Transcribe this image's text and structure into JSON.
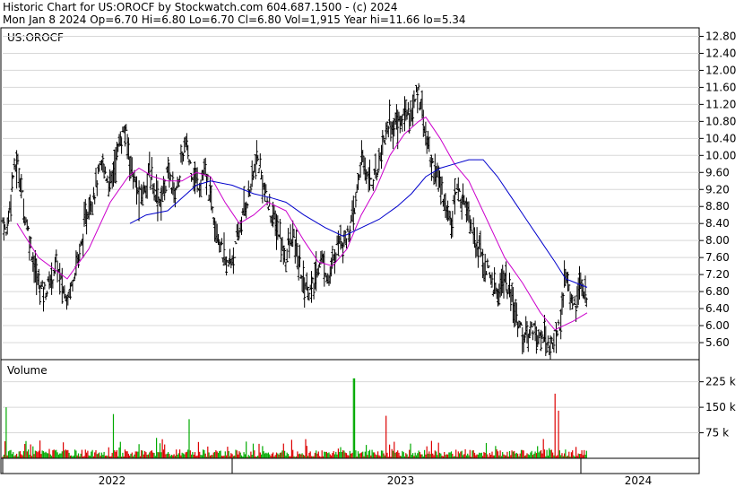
{
  "header": {
    "line1": "Historic Chart for US:OROCF by Stockwatch.com 604.687.1500 - (c) 2024",
    "line2": "Mon Jan  8 2024  Op=6.70  Hi=6.80  Lo=6.70  Cl=6.80  Vol=1,915  Year hi=11.66  lo=5.34"
  },
  "chart_data": [
    {
      "type": "candlestick",
      "panel_label": "US:OROCF",
      "ylim": [
        5.2,
        13.0
      ],
      "y_ticks": [
        "12.80",
        "12.40",
        "12.00",
        "11.60",
        "11.20",
        "10.80",
        "10.40",
        "10.00",
        "9.60",
        "9.20",
        "8.80",
        "8.40",
        "8.00",
        "7.60",
        "7.20",
        "6.80",
        "6.40",
        "6.00",
        "5.60"
      ],
      "x_labels": [
        "2022",
        "2023",
        "2024"
      ],
      "price_path": [
        [
          0,
          8.5
        ],
        [
          4,
          8.1
        ],
        [
          8,
          8.9
        ],
        [
          12,
          9.6
        ],
        [
          16,
          9.8
        ],
        [
          20,
          9.4
        ],
        [
          24,
          8.7
        ],
        [
          28,
          8.3
        ],
        [
          32,
          7.8
        ],
        [
          36,
          7.3
        ],
        [
          40,
          7.0
        ],
        [
          44,
          6.9
        ],
        [
          48,
          6.8
        ],
        [
          52,
          7.0
        ],
        [
          56,
          7.2
        ],
        [
          60,
          7.5
        ],
        [
          64,
          7.1
        ],
        [
          68,
          6.8
        ],
        [
          72,
          6.7
        ],
        [
          76,
          6.9
        ],
        [
          80,
          7.3
        ],
        [
          84,
          7.6
        ],
        [
          88,
          7.9
        ],
        [
          92,
          8.4
        ],
        [
          96,
          8.8
        ],
        [
          100,
          9.0
        ],
        [
          104,
          9.3
        ],
        [
          108,
          9.6
        ],
        [
          112,
          9.8
        ],
        [
          116,
          9.5
        ],
        [
          120,
          9.3
        ],
        [
          124,
          9.7
        ],
        [
          128,
          10.1
        ],
        [
          132,
          10.4
        ],
        [
          136,
          10.6
        ],
        [
          140,
          10.2
        ],
        [
          144,
          9.7
        ],
        [
          148,
          9.3
        ],
        [
          152,
          9.0
        ],
        [
          156,
          9.1
        ],
        [
          160,
          9.4
        ],
        [
          164,
          9.6
        ],
        [
          168,
          9.3
        ],
        [
          172,
          9.1
        ],
        [
          176,
          8.9
        ],
        [
          180,
          9.2
        ],
        [
          184,
          9.6
        ],
        [
          188,
          9.4
        ],
        [
          192,
          9.1
        ],
        [
          196,
          9.4
        ],
        [
          200,
          9.9
        ],
        [
          204,
          10.3
        ],
        [
          208,
          9.9
        ],
        [
          212,
          9.6
        ],
        [
          216,
          9.4
        ],
        [
          220,
          9.3
        ],
        [
          224,
          9.6
        ],
        [
          228,
          9.4
        ],
        [
          232,
          9.0
        ],
        [
          236,
          8.6
        ],
        [
          240,
          8.2
        ],
        [
          244,
          7.8
        ],
        [
          248,
          7.5
        ],
        [
          252,
          7.4
        ],
        [
          256,
          7.6
        ],
        [
          260,
          7.8
        ],
        [
          264,
          8.2
        ],
        [
          268,
          8.6
        ],
        [
          272,
          8.9
        ],
        [
          276,
          9.2
        ],
        [
          280,
          9.6
        ],
        [
          284,
          9.9
        ],
        [
          288,
          9.6
        ],
        [
          292,
          9.2
        ],
        [
          296,
          8.8
        ],
        [
          300,
          8.6
        ],
        [
          304,
          8.4
        ],
        [
          308,
          8.2
        ],
        [
          312,
          7.8
        ],
        [
          316,
          7.6
        ],
        [
          320,
          7.9
        ],
        [
          324,
          8.1
        ],
        [
          328,
          7.7
        ],
        [
          332,
          7.3
        ],
        [
          336,
          7.0
        ],
        [
          340,
          6.9
        ],
        [
          344,
          6.8
        ],
        [
          348,
          7.0
        ],
        [
          352,
          7.4
        ],
        [
          356,
          7.6
        ],
        [
          360,
          7.3
        ],
        [
          364,
          7.1
        ],
        [
          368,
          7.4
        ],
        [
          372,
          7.8
        ],
        [
          376,
          8.1
        ],
        [
          380,
          8.0
        ],
        [
          384,
          8.1
        ],
        [
          388,
          8.3
        ],
        [
          392,
          8.6
        ],
        [
          396,
          9.3
        ],
        [
          400,
          9.9
        ],
        [
          404,
          9.7
        ],
        [
          408,
          9.6
        ],
        [
          412,
          9.4
        ],
        [
          416,
          9.5
        ],
        [
          420,
          9.9
        ],
        [
          424,
          10.3
        ],
        [
          428,
          10.6
        ],
        [
          432,
          10.8
        ],
        [
          436,
          10.6
        ],
        [
          440,
          10.9
        ],
        [
          444,
          10.7
        ],
        [
          448,
          11.0
        ],
        [
          452,
          11.1
        ],
        [
          456,
          10.9
        ],
        [
          460,
          11.3
        ],
        [
          464,
          11.5
        ],
        [
          468,
          11.2
        ],
        [
          472,
          10.4
        ],
        [
          476,
          10.1
        ],
        [
          480,
          9.7
        ],
        [
          484,
          9.6
        ],
        [
          488,
          9.3
        ],
        [
          492,
          9.0
        ],
        [
          496,
          8.7
        ],
        [
          500,
          8.5
        ],
        [
          504,
          9.0
        ],
        [
          508,
          9.2
        ],
        [
          512,
          8.9
        ],
        [
          516,
          9.0
        ],
        [
          520,
          8.7
        ],
        [
          524,
          8.3
        ],
        [
          528,
          8.0
        ],
        [
          532,
          7.8
        ],
        [
          536,
          7.5
        ],
        [
          540,
          7.3
        ],
        [
          544,
          7.1
        ],
        [
          548,
          6.9
        ],
        [
          552,
          6.7
        ],
        [
          556,
          7.0
        ],
        [
          560,
          7.1
        ],
        [
          564,
          6.8
        ],
        [
          568,
          6.5
        ],
        [
          572,
          6.3
        ],
        [
          576,
          6.1
        ],
        [
          580,
          5.8
        ],
        [
          584,
          5.7
        ],
        [
          588,
          5.9
        ],
        [
          592,
          6.0
        ],
        [
          596,
          5.8
        ],
        [
          600,
          5.6
        ],
        [
          604,
          5.8
        ],
        [
          608,
          5.6
        ],
        [
          612,
          5.5
        ],
        [
          616,
          5.7
        ],
        [
          620,
          6.0
        ],
        [
          624,
          6.3
        ],
        [
          628,
          7.2
        ],
        [
          632,
          7.0
        ],
        [
          636,
          6.4
        ],
        [
          640,
          6.5
        ],
        [
          644,
          7.1
        ],
        [
          648,
          6.6
        ],
        [
          652,
          6.8
        ]
      ],
      "series": [
        {
          "name": "",
          "color": "#cc00cc",
          "points": [
            [
              16,
              8.4
            ],
            [
              40,
              7.6
            ],
            [
              72,
              7.1
            ],
            [
              96,
              7.8
            ],
            [
              120,
              8.9
            ],
            [
              140,
              9.5
            ],
            [
              152,
              9.7
            ],
            [
              168,
              9.5
            ],
            [
              184,
              9.4
            ],
            [
              200,
              9.4
            ],
            [
              216,
              9.6
            ],
            [
              232,
              9.5
            ],
            [
              248,
              8.9
            ],
            [
              264,
              8.4
            ],
            [
              280,
              8.6
            ],
            [
              296,
              8.9
            ],
            [
              316,
              8.7
            ],
            [
              336,
              8.0
            ],
            [
              352,
              7.5
            ],
            [
              368,
              7.4
            ],
            [
              384,
              7.8
            ],
            [
              400,
              8.6
            ],
            [
              416,
              9.2
            ],
            [
              432,
              10.0
            ],
            [
              448,
              10.5
            ],
            [
              464,
              10.8
            ],
            [
              472,
              10.9
            ],
            [
              488,
              10.4
            ],
            [
              504,
              9.8
            ],
            [
              520,
              9.4
            ],
            [
              540,
              8.5
            ],
            [
              560,
              7.6
            ],
            [
              580,
              7.0
            ],
            [
              600,
              6.3
            ],
            [
              616,
              5.9
            ],
            [
              636,
              6.1
            ],
            [
              652,
              6.3
            ]
          ]
        },
        {
          "name": "",
          "color": "#0000cc",
          "points": [
            [
              142,
              8.4
            ],
            [
              160,
              8.6
            ],
            [
              184,
              8.7
            ],
            [
              200,
              9.0
            ],
            [
              216,
              9.3
            ],
            [
              232,
              9.4
            ],
            [
              256,
              9.3
            ],
            [
              280,
              9.1
            ],
            [
              300,
              9.0
            ],
            [
              316,
              8.9
            ],
            [
              336,
              8.6
            ],
            [
              360,
              8.3
            ],
            [
              380,
              8.1
            ],
            [
              400,
              8.3
            ],
            [
              420,
              8.5
            ],
            [
              440,
              8.8
            ],
            [
              456,
              9.1
            ],
            [
              472,
              9.5
            ],
            [
              488,
              9.7
            ],
            [
              504,
              9.8
            ],
            [
              520,
              9.9
            ],
            [
              536,
              9.9
            ],
            [
              552,
              9.5
            ],
            [
              568,
              9.0
            ],
            [
              584,
              8.5
            ],
            [
              600,
              8.0
            ],
            [
              616,
              7.5
            ],
            [
              628,
              7.1
            ],
            [
              640,
              7.0
            ],
            [
              652,
              6.9
            ]
          ]
        }
      ]
    },
    {
      "type": "bar",
      "panel_label": "Volume",
      "ylim": [
        0,
        290
      ],
      "y_ticks": [
        "225 k",
        "150 k",
        "75 k"
      ],
      "y_tick_values": [
        225,
        150,
        75
      ],
      "up_color": "#00aa00",
      "down_color": "#dd0000",
      "spikes": [
        [
          392,
          235
        ],
        [
          616,
          190
        ],
        [
          620,
          140
        ],
        [
          428,
          125
        ],
        [
          124,
          130
        ],
        [
          208,
          115
        ],
        [
          4,
          150
        ]
      ]
    }
  ]
}
